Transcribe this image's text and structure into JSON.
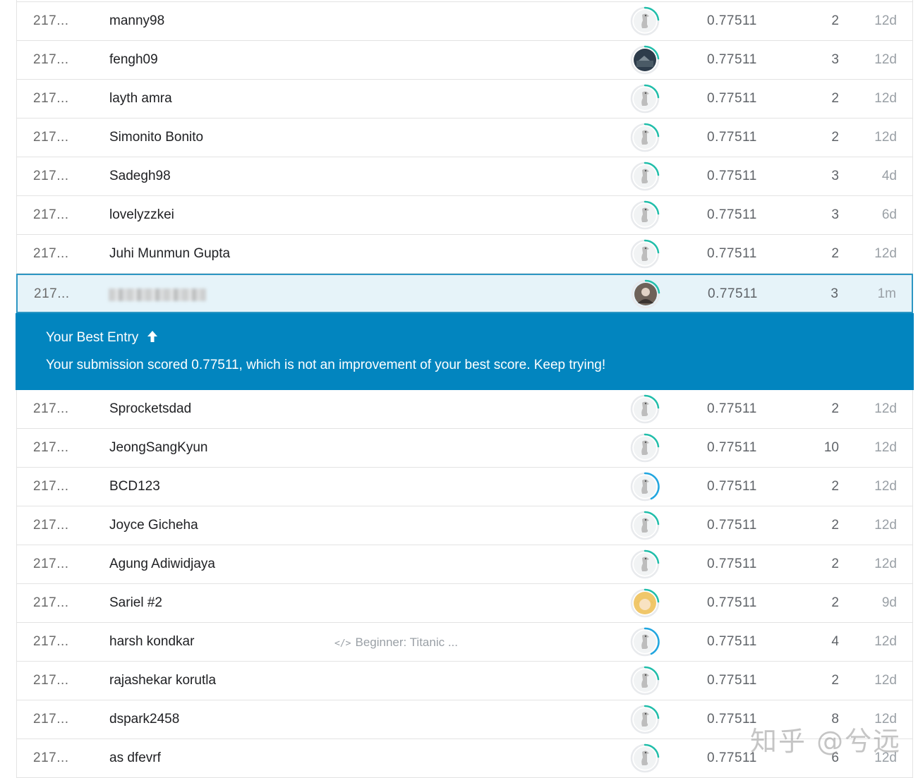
{
  "rows_top": [
    {
      "rank": "217...",
      "team": "manny98",
      "notebook": "",
      "avatar": "goose",
      "ring": "green",
      "score": "0.77511",
      "entries": "2",
      "last": "12d"
    },
    {
      "rank": "217...",
      "team": "fengh09",
      "notebook": "",
      "avatar": "photo-dark",
      "ring": "green",
      "score": "0.77511",
      "entries": "3",
      "last": "12d"
    },
    {
      "rank": "217...",
      "team": "layth amra",
      "notebook": "",
      "avatar": "goose",
      "ring": "green",
      "score": "0.77511",
      "entries": "2",
      "last": "12d"
    },
    {
      "rank": "217...",
      "team": "Simonito Bonito",
      "notebook": "",
      "avatar": "goose",
      "ring": "green",
      "score": "0.77511",
      "entries": "2",
      "last": "12d"
    },
    {
      "rank": "217...",
      "team": "Sadegh98",
      "notebook": "",
      "avatar": "goose",
      "ring": "green",
      "score": "0.77511",
      "entries": "3",
      "last": "4d"
    },
    {
      "rank": "217...",
      "team": "lovelyzzkei",
      "notebook": "",
      "avatar": "goose",
      "ring": "green",
      "score": "0.77511",
      "entries": "3",
      "last": "6d"
    },
    {
      "rank": "217...",
      "team": "Juhi Munmun Gupta",
      "notebook": "",
      "avatar": "goose",
      "ring": "green",
      "score": "0.77511",
      "entries": "2",
      "last": "12d"
    }
  ],
  "your_row": {
    "rank": "217...",
    "team": "",
    "avatar": "photo-person",
    "ring": "green",
    "score": "0.77511",
    "entries": "3",
    "last": "1m"
  },
  "banner": {
    "title": "Your Best Entry",
    "message": "Your submission scored 0.77511, which is not an improvement of your best score. Keep trying!"
  },
  "rows_bottom": [
    {
      "rank": "217...",
      "team": "Sprocketsdad",
      "notebook": "",
      "avatar": "goose",
      "ring": "green",
      "score": "0.77511",
      "entries": "2",
      "last": "12d"
    },
    {
      "rank": "217...",
      "team": "JeongSangKyun",
      "notebook": "",
      "avatar": "goose",
      "ring": "green",
      "score": "0.77511",
      "entries": "10",
      "last": "12d"
    },
    {
      "rank": "217...",
      "team": "BCD123",
      "notebook": "",
      "avatar": "goose",
      "ring": "blue",
      "score": "0.77511",
      "entries": "2",
      "last": "12d"
    },
    {
      "rank": "217...",
      "team": "Joyce Gicheha",
      "notebook": "",
      "avatar": "goose",
      "ring": "green",
      "score": "0.77511",
      "entries": "2",
      "last": "12d"
    },
    {
      "rank": "217...",
      "team": "Agung Adiwidjaya",
      "notebook": "",
      "avatar": "goose",
      "ring": "green",
      "score": "0.77511",
      "entries": "2",
      "last": "12d"
    },
    {
      "rank": "217...",
      "team": "Sariel #2",
      "notebook": "",
      "avatar": "photo-anime",
      "ring": "green",
      "score": "0.77511",
      "entries": "2",
      "last": "9d"
    },
    {
      "rank": "217...",
      "team": "harsh kondkar",
      "notebook": "Beginner: Titanic ...",
      "avatar": "goose",
      "ring": "blue",
      "score": "0.77511",
      "entries": "4",
      "last": "12d"
    },
    {
      "rank": "217...",
      "team": "rajashekar korutla",
      "notebook": "",
      "avatar": "goose",
      "ring": "green",
      "score": "0.77511",
      "entries": "2",
      "last": "12d"
    },
    {
      "rank": "217...",
      "team": "dspark2458",
      "notebook": "",
      "avatar": "goose",
      "ring": "green",
      "score": "0.77511",
      "entries": "8",
      "last": "12d"
    },
    {
      "rank": "217...",
      "team": "as dfevrf",
      "notebook": "",
      "avatar": "goose",
      "ring": "green",
      "score": "0.77511",
      "entries": "6",
      "last": "12d"
    }
  ],
  "watermark": "知乎 @兮远",
  "colors": {
    "banner": "#0285bf",
    "highlight_row": "#e6f3f9",
    "highlight_border": "#2c96c3",
    "ring_green": "#20beaa",
    "ring_blue": "#20a6e0"
  }
}
